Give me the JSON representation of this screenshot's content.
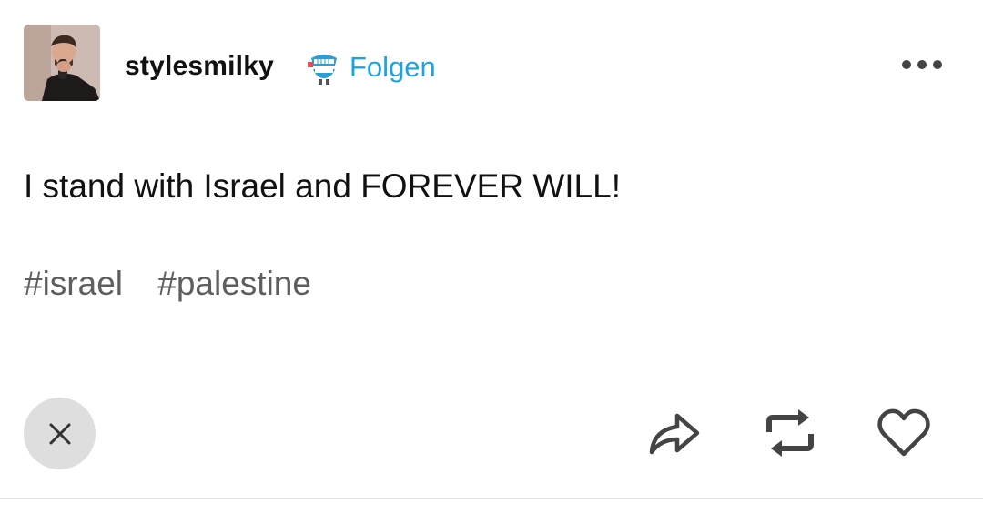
{
  "header": {
    "username": "stylesmilky",
    "follow_label": "Folgen",
    "accent_color": "#1fa3df"
  },
  "post": {
    "text": "I stand with Israel and FOREVER WILL!",
    "tags": [
      "#israel",
      "#palestine"
    ]
  },
  "icons": {
    "avatar": "avatar-photo",
    "badge": "chattering-teeth-badge-icon",
    "more": "more-options-icon",
    "close": "close-icon",
    "share": "share-arrow-icon",
    "reblog": "reblog-icon",
    "like": "heart-icon"
  }
}
